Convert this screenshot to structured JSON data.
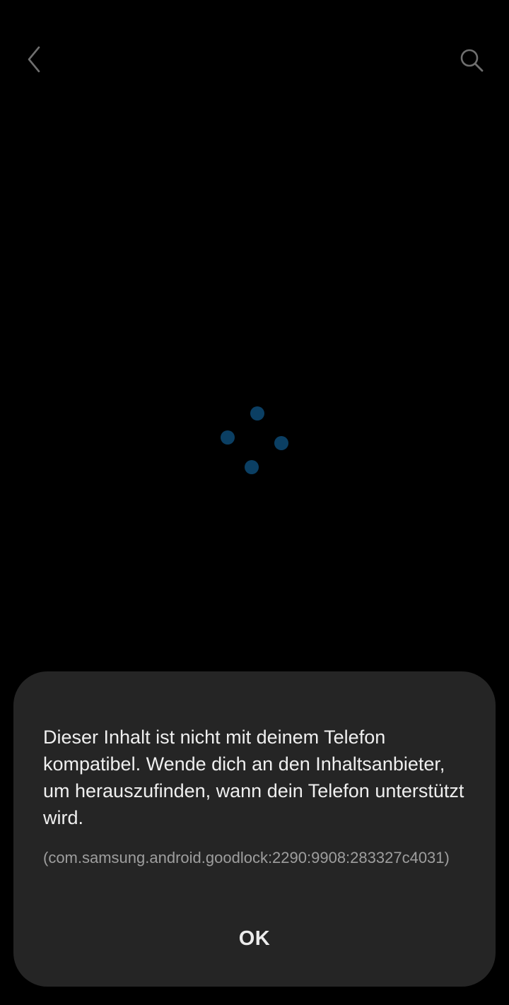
{
  "top_bar": {
    "back_icon": "chevron-left-icon",
    "search_icon": "search-icon"
  },
  "loading": {
    "indicator": "loading-dots-icon",
    "dot_color": "#0b3f63"
  },
  "dialog": {
    "message": "Dieser Inhalt ist nicht mit deinem Telefon kompatibel. Wende dich an den Inhaltsanbieter, um herauszufinden, wann dein Telefon unterstützt wird.",
    "error_code": "(com.samsung.android.goodlock:2290:9908:283327c4031)",
    "ok_label": "OK",
    "background_color": "#252525"
  }
}
